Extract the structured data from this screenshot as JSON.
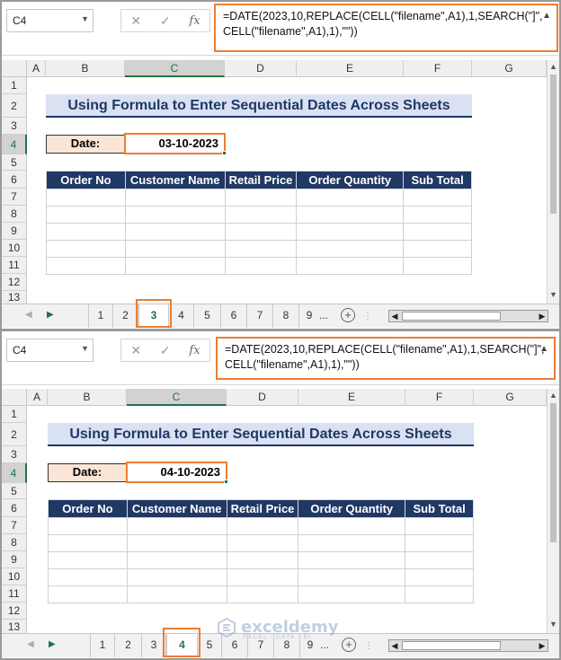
{
  "panes": [
    {
      "name_box": "C4",
      "formula": [
        "=DATE(2023,10,REPLACE(CELL(\"filename\",A1),1,SEARCH(\"]\",",
        "CELL(\"filename\",A1),1),\"\"))"
      ],
      "columns": [
        "A",
        "B",
        "C",
        "D",
        "E",
        "F",
        "G"
      ],
      "rows": [
        "1",
        "2",
        "3",
        "4",
        "5",
        "6",
        "7",
        "8",
        "9",
        "10",
        "11",
        "12",
        "13"
      ],
      "title": "Using Formula to Enter Sequential Dates Across Sheets",
      "date_label": "Date:",
      "date_value": "03-10-2023",
      "table_headers": [
        "Order No",
        "Customer Name",
        "Retail Price",
        "Order Quantity",
        "Sub Total"
      ],
      "sheets": [
        "1",
        "2",
        "3",
        "4",
        "5",
        "6",
        "7",
        "8",
        "9"
      ],
      "active_sheet": "3"
    },
    {
      "name_box": "C4",
      "formula": [
        "=DATE(2023,10,REPLACE(CELL(\"filename\",A1),1,SEARCH(\"]\",",
        "CELL(\"filename\",A1),1),\"\"))"
      ],
      "columns": [
        "A",
        "B",
        "C",
        "D",
        "E",
        "F",
        "G"
      ],
      "rows": [
        "1",
        "2",
        "3",
        "4",
        "5",
        "6",
        "7",
        "8",
        "9",
        "10",
        "11",
        "12",
        "13"
      ],
      "title": "Using Formula to Enter Sequential Dates Across Sheets",
      "date_label": "Date:",
      "date_value": "04-10-2023",
      "table_headers": [
        "Order No",
        "Customer Name",
        "Retail Price",
        "Order Quantity",
        "Sub Total"
      ],
      "sheets": [
        "1",
        "2",
        "3",
        "4",
        "5",
        "6",
        "7",
        "8",
        "9"
      ],
      "active_sheet": "4"
    }
  ],
  "tab_ellipsis": "...",
  "add_sheet_symbol": "+",
  "icons": {
    "cancel": "✕",
    "enter": "✓",
    "function": "fx"
  },
  "watermark": {
    "name": "exceldemy",
    "tagline": "EXCEL · DATA · BI"
  },
  "colors": {
    "accent": "#ed7d31",
    "header_fill": "#203864",
    "title_fill": "#dae1f3",
    "date_label_fill": "#fbe5d6",
    "excel_green": "#217346"
  }
}
